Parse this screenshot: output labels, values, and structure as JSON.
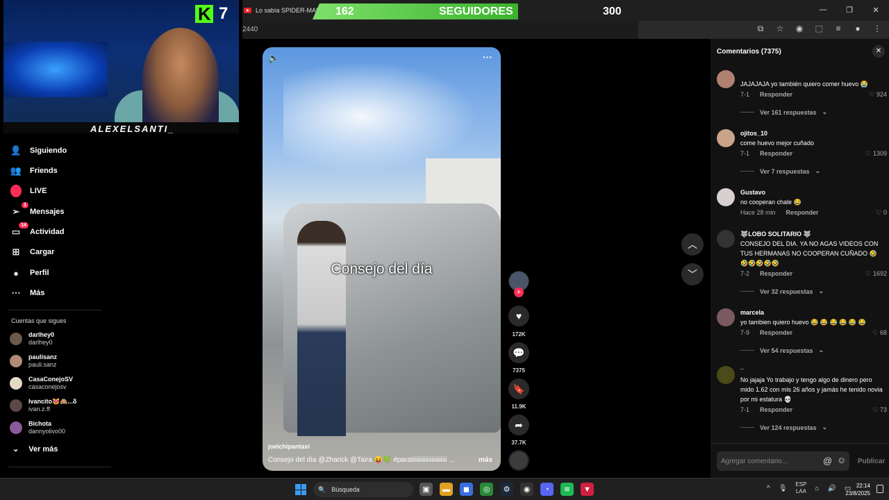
{
  "browser": {
    "tab_title": "Lo sabía SPIDER-MAN Bran",
    "url_fragment": "2440",
    "icons": [
      "screen-share-icon",
      "star-icon",
      "extension-icon",
      "puzzle-icon",
      "playlist-icon",
      "profile-icon",
      "menu-icon"
    ]
  },
  "banner": {
    "current": "162",
    "label": "SEGUIDORES",
    "goal": "300",
    "progress": 0.54
  },
  "overlay": {
    "kick_letter": "K",
    "kick_count": "7",
    "streamer_name": "ALEXELSANTI_"
  },
  "nav": {
    "items": [
      {
        "label": "Siguiendo",
        "icon": "user-follow-icon",
        "badge": ""
      },
      {
        "label": "Friends",
        "icon": "friends-icon",
        "badge": ""
      },
      {
        "label": "LIVE",
        "icon": "live-icon",
        "badge": ""
      },
      {
        "label": "Mensajes",
        "icon": "send-icon",
        "badge": "1"
      },
      {
        "label": "Actividad",
        "icon": "inbox-icon",
        "badge": "14"
      },
      {
        "label": "Cargar",
        "icon": "upload-icon",
        "badge": ""
      },
      {
        "label": "Perfil",
        "icon": "profile-icon",
        "badge": ""
      },
      {
        "label": "Más",
        "icon": "more-icon",
        "badge": ""
      }
    ],
    "following_title": "Cuentas que sigues",
    "following": [
      {
        "name": "darlhey0",
        "handle": "darlhey0"
      },
      {
        "name": "paulisanz",
        "handle": "pauli.sanz"
      },
      {
        "name": "CasaConejoSV",
        "handle": "casaconejosv"
      },
      {
        "name": "Ivancito😻🙈...δ",
        "handle": "ivan.z.ff"
      },
      {
        "name": "Bichota",
        "handle": "dannyolivo00"
      }
    ],
    "see_more": "Ver más"
  },
  "video": {
    "caption": "Consejo del día",
    "author": "joelchipantaxi",
    "description": "Consejo del día @Zharick  @Taira 😝🍀    #paratiiiiiiiiiiiiiiiiiiiiii ...",
    "more": "más"
  },
  "actions": {
    "likes": "172K",
    "comments": "7375",
    "saves": "11.9K",
    "shares": "37.7K"
  },
  "comments": {
    "title": "Comentarios (7375)",
    "input_placeholder": "Agregar comentario...",
    "post_label": "Publicar",
    "reply_label": "Responder",
    "items": [
      {
        "user": "",
        "text": "JAJAJAJA yo también quiero comer huevo 😭",
        "date": "7-1",
        "likes": "924",
        "replies": "Ver 161 respuestas"
      },
      {
        "user": "ojitos_10",
        "text": "come huevo mejor cuñado",
        "date": "7-1",
        "likes": "1309",
        "replies": "Ver 7 respuestas"
      },
      {
        "user": "Gustavo",
        "text": "no cooperan chale 😂",
        "date": "Hace 28 min",
        "likes": "0",
        "replies": ""
      },
      {
        "user": "🐺LOBO SOLITARIO 🐺",
        "text": "CONSEJO DEL DIA. YA NO AGAS VIDEOS CON TUS HERMANAS NO COOPERAN CUÑADO 🤣 🤣🤣🤣🤣🤣",
        "date": "7-2",
        "likes": "1692",
        "replies": "Ver 32 respuestas"
      },
      {
        "user": "marcela",
        "text": "yo tambien quiero huevo 😂 😂 😂 😂 😂 😂",
        "date": "7-9",
        "likes": "68",
        "replies": "Ver 54 respuestas"
      },
      {
        "user": "_",
        "text": "No jajaja Yo trabajo y tengo algo de dinero pero mido 1.62 con mis 26 años y jamás he tenido novia por mi estatura 💀",
        "date": "7-1",
        "likes": "73",
        "replies": "Ver 124 respuestas"
      }
    ]
  },
  "taskbar": {
    "search": "Búsqueda",
    "lang_top": "ESP",
    "lang_bottom": "LAA",
    "time": "22:14",
    "date": "23/8/2025"
  }
}
